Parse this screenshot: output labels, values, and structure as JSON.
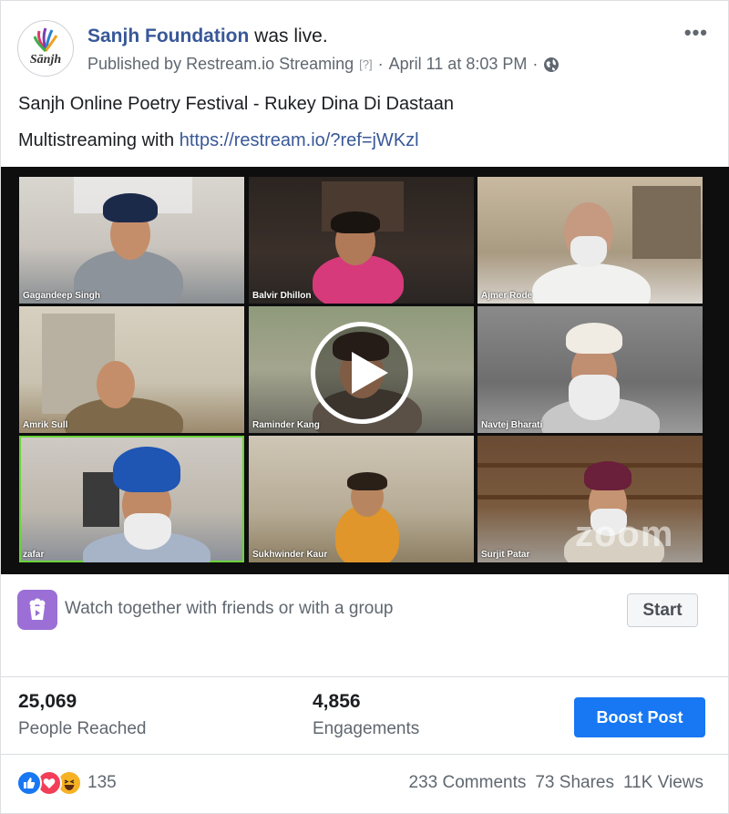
{
  "header": {
    "page_name": "Sanjh Foundation",
    "live_text": "was live.",
    "published_by": "Published by Restream.io Streaming",
    "published_qmark": "[?]",
    "sep1": "·",
    "date": "April 11 at 8:03 PM",
    "sep2": "·",
    "privacy_icon": "globe-icon",
    "more_icon": "more-options-icon",
    "avatar_label": "Sānjh"
  },
  "post": {
    "line1": "Sanjh Online Poetry Festival - Rukey Dina Di Dastaan",
    "line2_prefix": "Multistreaming with",
    "link": "https://restream.io/?ref=jWKzl"
  },
  "video": {
    "participants": [
      "Gagandeep Singh",
      "Balvir Dhillon",
      "Ajmer Rode",
      "Amrik Sull",
      "Raminder Kang",
      "Navtej Bharati",
      "zafar",
      "Sukhwinder Kaur",
      "Surjit Patar"
    ],
    "active_speaker": "zafar",
    "watermark": "zoom",
    "play_icon": "play-icon"
  },
  "watch_together": {
    "text": "Watch together with friends or with a group",
    "button": "Start",
    "icon": "watch-party-icon"
  },
  "insights": {
    "reach_value": "25,069",
    "reach_label": "People Reached",
    "engage_value": "4,856",
    "engage_label": "Engagements",
    "boost_label": "Boost Post"
  },
  "footer": {
    "reactions": [
      "like-icon",
      "love-icon",
      "haha-icon"
    ],
    "reaction_count": "135",
    "comments": "233 Comments",
    "shares": "73 Shares",
    "views": "11K Views"
  },
  "colors": {
    "link": "#385898",
    "boost": "#1877f2",
    "active_tile": "#6ad43a",
    "watch_icon_bg": "#9b6fd6"
  }
}
